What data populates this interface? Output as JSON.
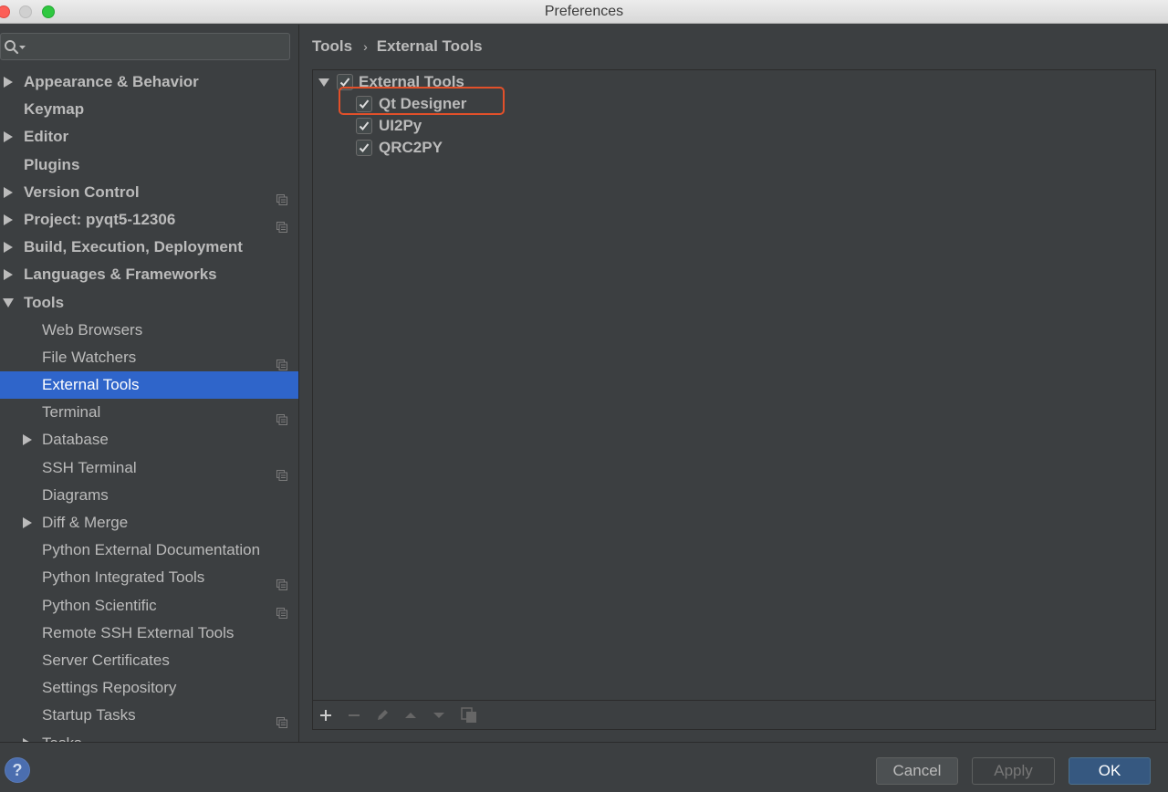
{
  "window": {
    "title": "Preferences"
  },
  "search": {
    "placeholder": ""
  },
  "sidebar": {
    "items": [
      {
        "label": "Appearance & Behavior",
        "level": 0,
        "bold": true,
        "arrow": "right",
        "project_icon": false,
        "selected": false,
        "name": "sidebar-item-appearance-behavior"
      },
      {
        "label": "Keymap",
        "level": 0,
        "bold": true,
        "arrow": "none",
        "project_icon": false,
        "selected": false,
        "name": "sidebar-item-keymap"
      },
      {
        "label": "Editor",
        "level": 0,
        "bold": true,
        "arrow": "right",
        "project_icon": false,
        "selected": false,
        "name": "sidebar-item-editor"
      },
      {
        "label": "Plugins",
        "level": 0,
        "bold": true,
        "arrow": "none",
        "project_icon": false,
        "selected": false,
        "name": "sidebar-item-plugins"
      },
      {
        "label": "Version Control",
        "level": 0,
        "bold": true,
        "arrow": "right",
        "project_icon": true,
        "selected": false,
        "name": "sidebar-item-version-control"
      },
      {
        "label": "Project: pyqt5-12306",
        "level": 0,
        "bold": true,
        "arrow": "right",
        "project_icon": true,
        "selected": false,
        "name": "sidebar-item-project"
      },
      {
        "label": "Build, Execution, Deployment",
        "level": 0,
        "bold": true,
        "arrow": "right",
        "project_icon": false,
        "selected": false,
        "name": "sidebar-item-build-execution-deployment"
      },
      {
        "label": "Languages & Frameworks",
        "level": 0,
        "bold": true,
        "arrow": "right",
        "project_icon": false,
        "selected": false,
        "name": "sidebar-item-languages-frameworks"
      },
      {
        "label": "Tools",
        "level": 0,
        "bold": true,
        "arrow": "down",
        "project_icon": false,
        "selected": false,
        "name": "sidebar-item-tools"
      },
      {
        "label": "Web Browsers",
        "level": 1,
        "bold": false,
        "arrow": "none",
        "project_icon": false,
        "selected": false,
        "name": "sidebar-item-web-browsers"
      },
      {
        "label": "File Watchers",
        "level": 1,
        "bold": false,
        "arrow": "none",
        "project_icon": true,
        "selected": false,
        "name": "sidebar-item-file-watchers"
      },
      {
        "label": "External Tools",
        "level": 1,
        "bold": false,
        "arrow": "none",
        "project_icon": false,
        "selected": true,
        "name": "sidebar-item-external-tools"
      },
      {
        "label": "Terminal",
        "level": 1,
        "bold": false,
        "arrow": "none",
        "project_icon": true,
        "selected": false,
        "name": "sidebar-item-terminal"
      },
      {
        "label": "Database",
        "level": 1,
        "bold": false,
        "arrow": "right",
        "project_icon": false,
        "selected": false,
        "name": "sidebar-item-database"
      },
      {
        "label": "SSH Terminal",
        "level": 1,
        "bold": false,
        "arrow": "none",
        "project_icon": true,
        "selected": false,
        "name": "sidebar-item-ssh-terminal"
      },
      {
        "label": "Diagrams",
        "level": 1,
        "bold": false,
        "arrow": "none",
        "project_icon": false,
        "selected": false,
        "name": "sidebar-item-diagrams"
      },
      {
        "label": "Diff & Merge",
        "level": 1,
        "bold": false,
        "arrow": "right",
        "project_icon": false,
        "selected": false,
        "name": "sidebar-item-diff-merge"
      },
      {
        "label": "Python External Documentation",
        "level": 1,
        "bold": false,
        "arrow": "none",
        "project_icon": false,
        "selected": false,
        "name": "sidebar-item-python-external-documentation"
      },
      {
        "label": "Python Integrated Tools",
        "level": 1,
        "bold": false,
        "arrow": "none",
        "project_icon": true,
        "selected": false,
        "name": "sidebar-item-python-integrated-tools"
      },
      {
        "label": "Python Scientific",
        "level": 1,
        "bold": false,
        "arrow": "none",
        "project_icon": true,
        "selected": false,
        "name": "sidebar-item-python-scientific"
      },
      {
        "label": "Remote SSH External Tools",
        "level": 1,
        "bold": false,
        "arrow": "none",
        "project_icon": false,
        "selected": false,
        "name": "sidebar-item-remote-ssh-external-tools"
      },
      {
        "label": "Server Certificates",
        "level": 1,
        "bold": false,
        "arrow": "none",
        "project_icon": false,
        "selected": false,
        "name": "sidebar-item-server-certificates"
      },
      {
        "label": "Settings Repository",
        "level": 1,
        "bold": false,
        "arrow": "none",
        "project_icon": false,
        "selected": false,
        "name": "sidebar-item-settings-repository"
      },
      {
        "label": "Startup Tasks",
        "level": 1,
        "bold": false,
        "arrow": "none",
        "project_icon": true,
        "selected": false,
        "name": "sidebar-item-startup-tasks"
      },
      {
        "label": "Tasks",
        "level": 1,
        "bold": false,
        "arrow": "right",
        "project_icon": true,
        "selected": false,
        "name": "sidebar-item-tasks"
      }
    ]
  },
  "breadcrumb": {
    "parent": "Tools",
    "separator": "›",
    "current": "External Tools"
  },
  "tools_tree": {
    "group": {
      "label": "External Tools",
      "checked": true,
      "expanded": true
    },
    "items": [
      {
        "label": "Qt Designer",
        "checked": true,
        "highlighted": true
      },
      {
        "label": "UI2Py",
        "checked": true,
        "highlighted": false
      },
      {
        "label": "QRC2PY",
        "checked": true,
        "highlighted": false
      }
    ]
  },
  "toolbar": {
    "add": "add-icon",
    "remove": "remove-icon",
    "edit": "edit-icon",
    "move_up": "move-up-icon",
    "move_down": "move-down-icon",
    "copy": "copy-icon"
  },
  "footer": {
    "help_label": "?",
    "cancel_label": "Cancel",
    "apply_label": "Apply",
    "ok_label": "OK"
  },
  "colors": {
    "background": "#3c3f41",
    "selection": "#2f65ca",
    "highlight_box": "#e2502a",
    "ok_button": "#365880",
    "text": "#bbbbbb"
  }
}
